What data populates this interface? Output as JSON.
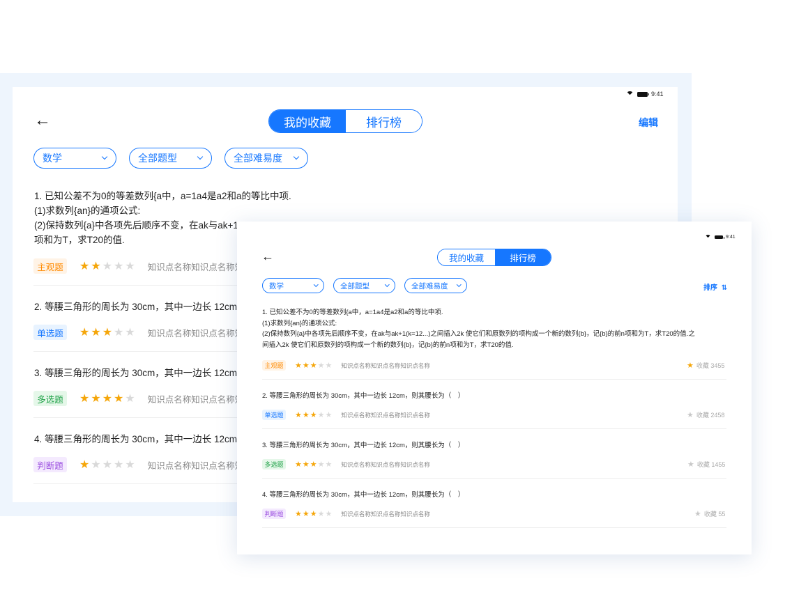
{
  "status": {
    "time": "9:41"
  },
  "tabs": {
    "favorites": "我的收藏",
    "ranking": "排行榜"
  },
  "header": {
    "edit": "编辑",
    "sort": "排序"
  },
  "filters": {
    "subject": "数学",
    "type": "全部题型",
    "difficulty": "全部难易度"
  },
  "back_questions": {
    "q1": {
      "line1": "1. 已知公差不为0的等差数列{a中，a=1a4是a2和a的等比中项.",
      "line2": "(1)求数列{an}的通项公式:",
      "line3": "(2)保持数列{a}中各项先后顺序不变，在ak与ak+1",
      "line4": "项和为T，求T20的值."
    },
    "q2": "2. 等腰三角形的周长为 30cm，其中一边长 12cm",
    "q3": "3. 等腰三角形的周长为 30cm，其中一边长 12cm",
    "q4": "4. 等腰三角形的周长为 30cm，其中一边长 12cm",
    "kp": "知识点名称知识点名称知"
  },
  "front_questions": {
    "q1": {
      "line1": "1. 已知公差不为0的等差数列{a中，a=1a4是a2和a的等比中项.",
      "line2": "(1)求数列{an}的通项公式:",
      "line3": "(2)保持数列{a}中各项先后顺序不变，在ak与ak+1(k=12...)之间插入2k 使它们和原数列的项构成一个新的数列{b}，记{b}的前n项和为T，求T20的值.之",
      "line4": "间插入2k 使它们和原数列的项构成一个新的数列{b}，记{b}的前n项和为T，求T20的值."
    },
    "q2": "2. 等腰三角形的周长为 30cm，其中一边长 12cm，则其腰长为（　）",
    "q3": "3. 等腰三角形的周长为 30cm，其中一边长 12cm，则其腰长为（　）",
    "q4": "4. 等腰三角形的周长为 30cm，其中一边长 12cm，则其腰长为（　）",
    "kp": "知识点名称知识点名称知识点名称"
  },
  "tags": {
    "subjective": "主观题",
    "single": "单选题",
    "multiple": "多选题",
    "judge": "判断题"
  },
  "ratings": {
    "back": [
      2,
      3,
      4,
      1
    ],
    "front": [
      3,
      3,
      3,
      3
    ],
    "max": 5
  },
  "favorites": [
    {
      "label": "收藏 3455",
      "starred": true
    },
    {
      "label": "收藏 2458",
      "starred": false
    },
    {
      "label": "收藏 1455",
      "starred": false
    },
    {
      "label": "收藏 55",
      "starred": false
    }
  ],
  "colors": {
    "accent": "#1677ff",
    "star": "#f5a60a"
  },
  "icons": [
    "back-arrow-icon",
    "wifi-icon",
    "battery-icon",
    "chevron-down-icon",
    "star-icon",
    "sort-icon"
  ]
}
